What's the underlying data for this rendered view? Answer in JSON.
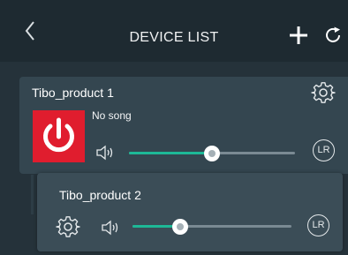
{
  "header": {
    "title": "DEVICE LIST",
    "back_icon": "chevron-left-icon",
    "add_icon": "plus-icon",
    "refresh_icon": "refresh-icon"
  },
  "devices": [
    {
      "name": "Tibo_product 1",
      "song": "No song",
      "volume": 0.5,
      "channel": "LR",
      "power_state": "on",
      "power_color": "#e01d2e"
    },
    {
      "name": "Tibo_product 2",
      "volume": 0.3,
      "channel": "LR"
    }
  ],
  "colors": {
    "accent": "#1db896",
    "background": "#1f2a31",
    "card": "#344650"
  }
}
